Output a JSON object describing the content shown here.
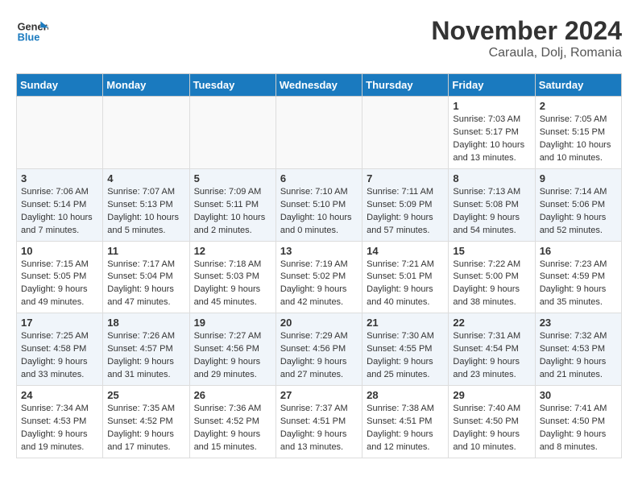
{
  "header": {
    "logo_line1": "General",
    "logo_line2": "Blue",
    "month": "November 2024",
    "location": "Caraula, Dolj, Romania"
  },
  "weekdays": [
    "Sunday",
    "Monday",
    "Tuesday",
    "Wednesday",
    "Thursday",
    "Friday",
    "Saturday"
  ],
  "weeks": [
    [
      {
        "day": "",
        "info": ""
      },
      {
        "day": "",
        "info": ""
      },
      {
        "day": "",
        "info": ""
      },
      {
        "day": "",
        "info": ""
      },
      {
        "day": "",
        "info": ""
      },
      {
        "day": "1",
        "info": "Sunrise: 7:03 AM\nSunset: 5:17 PM\nDaylight: 10 hours and 13 minutes."
      },
      {
        "day": "2",
        "info": "Sunrise: 7:05 AM\nSunset: 5:15 PM\nDaylight: 10 hours and 10 minutes."
      }
    ],
    [
      {
        "day": "3",
        "info": "Sunrise: 7:06 AM\nSunset: 5:14 PM\nDaylight: 10 hours and 7 minutes."
      },
      {
        "day": "4",
        "info": "Sunrise: 7:07 AM\nSunset: 5:13 PM\nDaylight: 10 hours and 5 minutes."
      },
      {
        "day": "5",
        "info": "Sunrise: 7:09 AM\nSunset: 5:11 PM\nDaylight: 10 hours and 2 minutes."
      },
      {
        "day": "6",
        "info": "Sunrise: 7:10 AM\nSunset: 5:10 PM\nDaylight: 10 hours and 0 minutes."
      },
      {
        "day": "7",
        "info": "Sunrise: 7:11 AM\nSunset: 5:09 PM\nDaylight: 9 hours and 57 minutes."
      },
      {
        "day": "8",
        "info": "Sunrise: 7:13 AM\nSunset: 5:08 PM\nDaylight: 9 hours and 54 minutes."
      },
      {
        "day": "9",
        "info": "Sunrise: 7:14 AM\nSunset: 5:06 PM\nDaylight: 9 hours and 52 minutes."
      }
    ],
    [
      {
        "day": "10",
        "info": "Sunrise: 7:15 AM\nSunset: 5:05 PM\nDaylight: 9 hours and 49 minutes."
      },
      {
        "day": "11",
        "info": "Sunrise: 7:17 AM\nSunset: 5:04 PM\nDaylight: 9 hours and 47 minutes."
      },
      {
        "day": "12",
        "info": "Sunrise: 7:18 AM\nSunset: 5:03 PM\nDaylight: 9 hours and 45 minutes."
      },
      {
        "day": "13",
        "info": "Sunrise: 7:19 AM\nSunset: 5:02 PM\nDaylight: 9 hours and 42 minutes."
      },
      {
        "day": "14",
        "info": "Sunrise: 7:21 AM\nSunset: 5:01 PM\nDaylight: 9 hours and 40 minutes."
      },
      {
        "day": "15",
        "info": "Sunrise: 7:22 AM\nSunset: 5:00 PM\nDaylight: 9 hours and 38 minutes."
      },
      {
        "day": "16",
        "info": "Sunrise: 7:23 AM\nSunset: 4:59 PM\nDaylight: 9 hours and 35 minutes."
      }
    ],
    [
      {
        "day": "17",
        "info": "Sunrise: 7:25 AM\nSunset: 4:58 PM\nDaylight: 9 hours and 33 minutes."
      },
      {
        "day": "18",
        "info": "Sunrise: 7:26 AM\nSunset: 4:57 PM\nDaylight: 9 hours and 31 minutes."
      },
      {
        "day": "19",
        "info": "Sunrise: 7:27 AM\nSunset: 4:56 PM\nDaylight: 9 hours and 29 minutes."
      },
      {
        "day": "20",
        "info": "Sunrise: 7:29 AM\nSunset: 4:56 PM\nDaylight: 9 hours and 27 minutes."
      },
      {
        "day": "21",
        "info": "Sunrise: 7:30 AM\nSunset: 4:55 PM\nDaylight: 9 hours and 25 minutes."
      },
      {
        "day": "22",
        "info": "Sunrise: 7:31 AM\nSunset: 4:54 PM\nDaylight: 9 hours and 23 minutes."
      },
      {
        "day": "23",
        "info": "Sunrise: 7:32 AM\nSunset: 4:53 PM\nDaylight: 9 hours and 21 minutes."
      }
    ],
    [
      {
        "day": "24",
        "info": "Sunrise: 7:34 AM\nSunset: 4:53 PM\nDaylight: 9 hours and 19 minutes."
      },
      {
        "day": "25",
        "info": "Sunrise: 7:35 AM\nSunset: 4:52 PM\nDaylight: 9 hours and 17 minutes."
      },
      {
        "day": "26",
        "info": "Sunrise: 7:36 AM\nSunset: 4:52 PM\nDaylight: 9 hours and 15 minutes."
      },
      {
        "day": "27",
        "info": "Sunrise: 7:37 AM\nSunset: 4:51 PM\nDaylight: 9 hours and 13 minutes."
      },
      {
        "day": "28",
        "info": "Sunrise: 7:38 AM\nSunset: 4:51 PM\nDaylight: 9 hours and 12 minutes."
      },
      {
        "day": "29",
        "info": "Sunrise: 7:40 AM\nSunset: 4:50 PM\nDaylight: 9 hours and 10 minutes."
      },
      {
        "day": "30",
        "info": "Sunrise: 7:41 AM\nSunset: 4:50 PM\nDaylight: 9 hours and 8 minutes."
      }
    ]
  ]
}
